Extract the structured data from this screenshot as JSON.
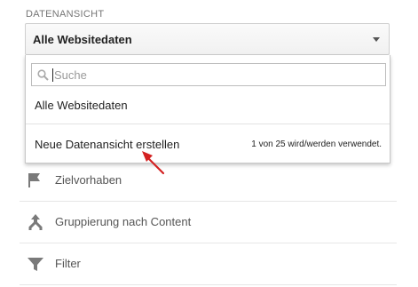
{
  "view_section": {
    "label": "DATENANSICHT",
    "selected_value": "Alle Websitedaten",
    "caret_icon": "triangle-down-icon"
  },
  "dropdown": {
    "search": {
      "placeholder": "Suche",
      "value": "",
      "icon": "search-icon"
    },
    "options": [
      {
        "label": "Alle Websitedaten"
      }
    ],
    "create_link": "Neue Datenansicht erstellen",
    "usage_text": "1 von 25 wird/werden verwendet."
  },
  "nav_items": [
    {
      "label": "Zielvorhaben",
      "icon": "flag-icon"
    },
    {
      "label": "Gruppierung nach Content",
      "icon": "merge-arrow-icon"
    },
    {
      "label": "Filter",
      "icon": "filter-icon"
    }
  ],
  "colors": {
    "annotation_arrow": "#d32121",
    "icon_gray": "#7a7a7a",
    "divider": "#e6e6e6"
  }
}
